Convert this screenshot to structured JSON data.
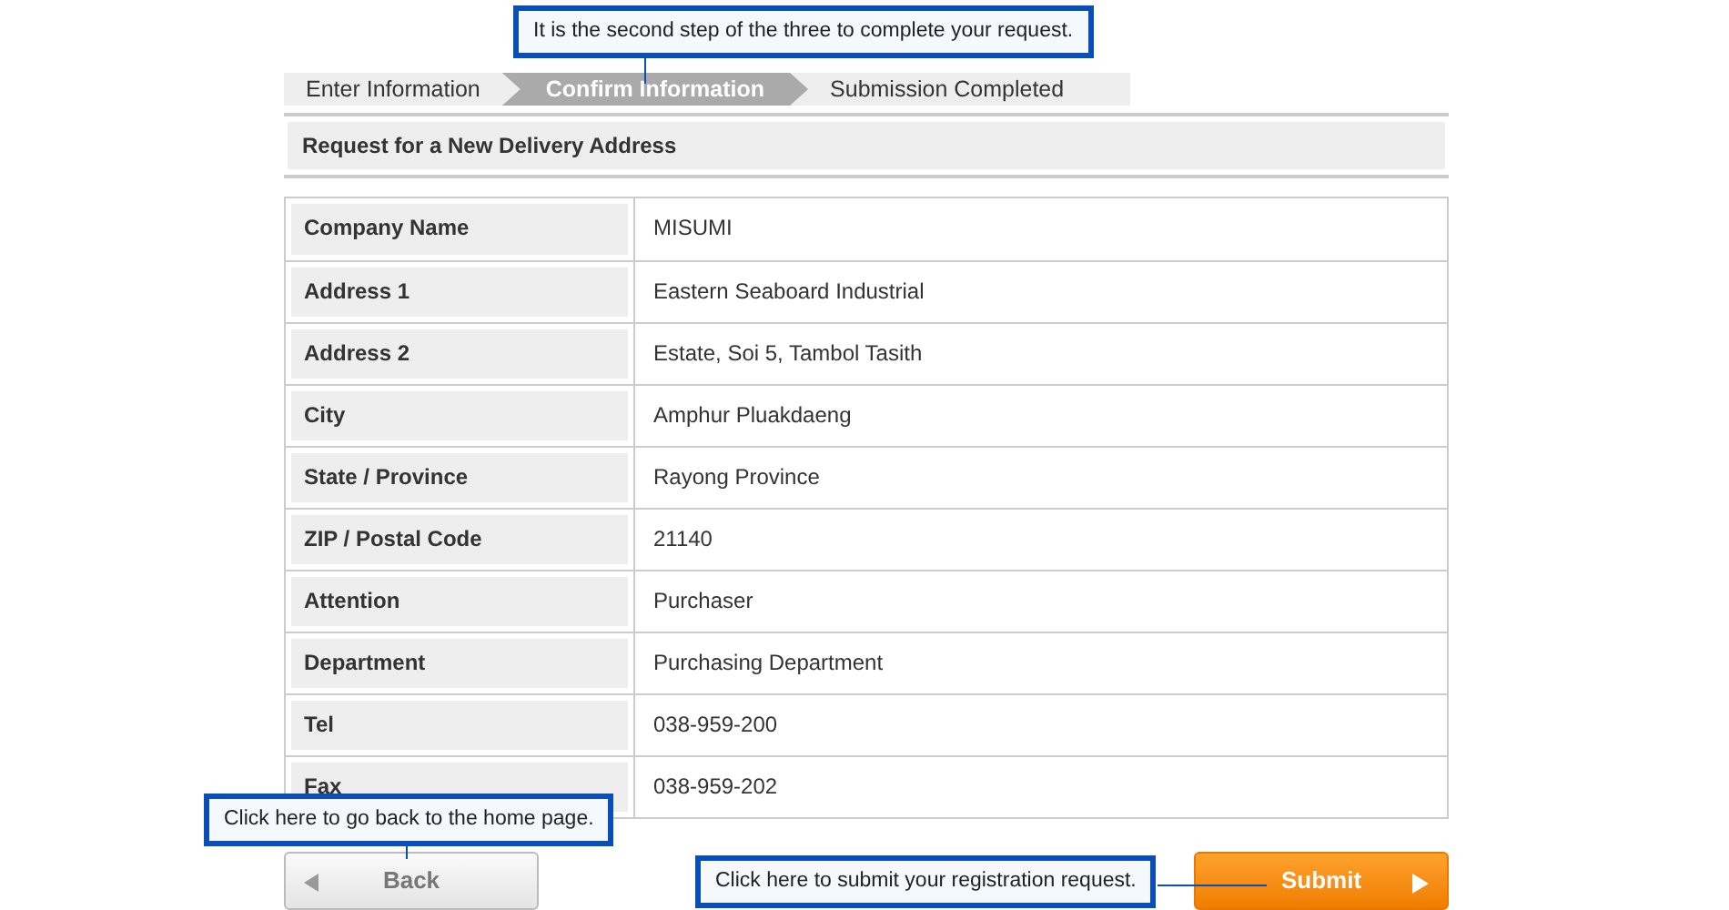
{
  "steps": [
    {
      "label": "Enter Information",
      "selected": false
    },
    {
      "label": "Confirm Information",
      "selected": true
    },
    {
      "label": "Submission Completed",
      "selected": false
    }
  ],
  "steps_callout": "It is the second step of the three to complete your request.",
  "section_title": "Request for a New Delivery Address",
  "rows": [
    {
      "label": "Company Name",
      "value": "MISUMI"
    },
    {
      "label": "Address 1",
      "value": "Eastern Seaboard Industrial"
    },
    {
      "label": "Address 2",
      "value": "Estate, Soi 5, Tambol Tasith"
    },
    {
      "label": "City",
      "value": "Amphur Pluakdaeng"
    },
    {
      "label": "State / Province",
      "value": "Rayong Province"
    },
    {
      "label": "ZIP / Postal Code",
      "value": "21140"
    },
    {
      "label": "Attention",
      "value": "Purchaser"
    },
    {
      "label": "Department",
      "value": "Purchasing Department"
    },
    {
      "label": "Tel",
      "value": "038-959-200"
    },
    {
      "label": "Fax",
      "value": "038-959-202"
    }
  ],
  "back_button": {
    "label": "Back",
    "callout": "Click here to go back to the home page."
  },
  "submit_button": {
    "label": "Submit",
    "callout": "Click here to submit your registration request."
  }
}
